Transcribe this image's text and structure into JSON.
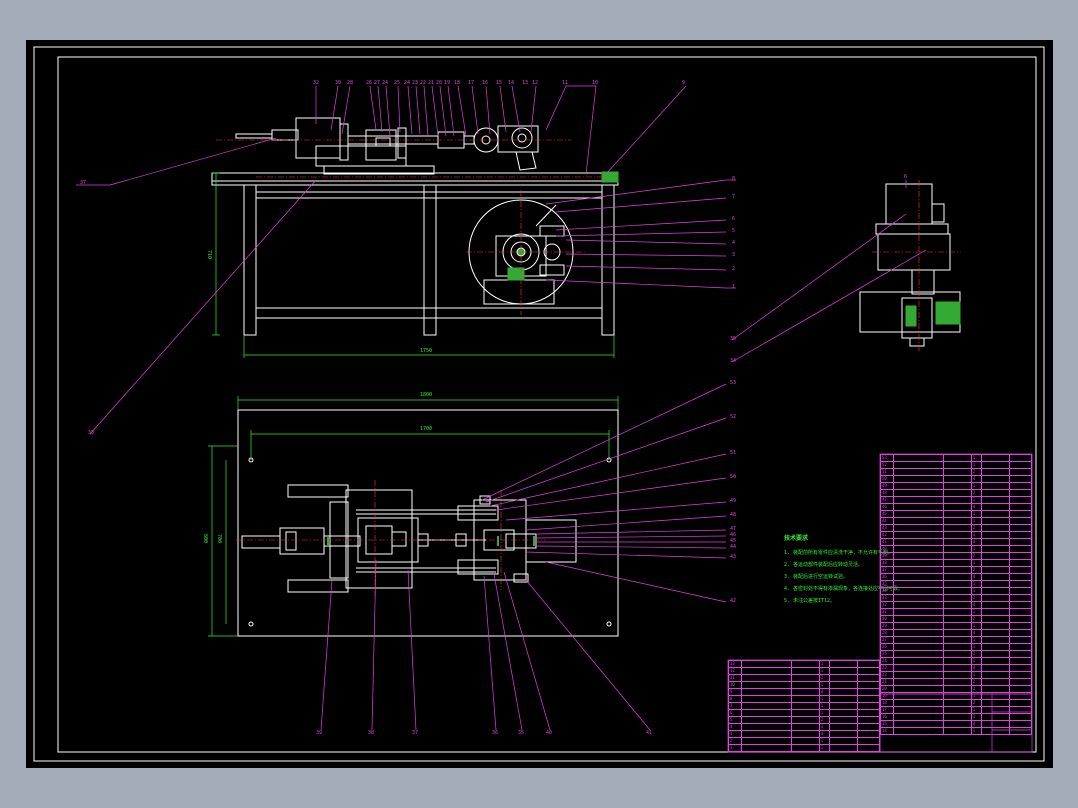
{
  "drawing": {
    "colors": {
      "background": "#000000",
      "frame_outer": "#ffffff",
      "part": "#ffffff",
      "leader": "#e040e0",
      "dimension": "#33ee33",
      "centerline": "#ff3333",
      "hatch_green": "#33aa33",
      "notes": "#33ee33"
    }
  },
  "callouts": {
    "front_top": [
      "32",
      "30",
      "28",
      "26",
      "27",
      "24",
      "25",
      "24",
      "23",
      "22",
      "21",
      "20",
      "19",
      "18",
      "17",
      "16",
      "15",
      "14",
      "13",
      "12",
      "11",
      "10",
      "9"
    ],
    "side_right": [
      "8",
      "7",
      "6",
      "5",
      "4",
      "3",
      "2",
      "1"
    ],
    "left": [
      "37",
      "33"
    ],
    "end_view": [
      "6",
      "35",
      "34"
    ],
    "plan_right": [
      "53",
      "52",
      "51",
      "50",
      "49",
      "48",
      "47",
      "46",
      "45",
      "44",
      "43",
      "42"
    ],
    "plan_bottom": [
      "39",
      "38",
      "37",
      "36",
      "35",
      "40",
      "41"
    ]
  },
  "dimensions": {
    "frame_length": "1750",
    "frame_height": "710",
    "base_length": "1800",
    "base_inner": "1700",
    "base_width": "800",
    "base_inner_width": "700"
  },
  "notes": {
    "title": "技术要求",
    "lines": [
      "1. 装配前所有零件应清洗干净，不允许有毛刺。",
      "2. 各运动部件装配后应转动灵活。",
      "3. 装配后进行空运转试验。",
      "4. 各密封处不得有渗漏现象，各连接处应牢固可靠。",
      "5. 未注公差按IT12。"
    ]
  },
  "bom_right": {
    "rows": [
      [
        "53",
        "",
        "",
        "1",
        "",
        ""
      ],
      [
        "52",
        "",
        "",
        "1",
        "",
        ""
      ],
      [
        "51",
        "",
        "",
        "2",
        "",
        ""
      ],
      [
        "50",
        "",
        "",
        "4",
        "",
        ""
      ],
      [
        "49",
        "",
        "",
        "1",
        "",
        ""
      ],
      [
        "48",
        "",
        "",
        "2",
        "",
        ""
      ],
      [
        "47",
        "",
        "",
        "1",
        "",
        ""
      ],
      [
        "46",
        "",
        "",
        "4",
        "",
        ""
      ],
      [
        "45",
        "",
        "",
        "1",
        "",
        ""
      ],
      [
        "44",
        "",
        "",
        "1",
        "",
        ""
      ],
      [
        "43",
        "",
        "",
        "2",
        "",
        ""
      ],
      [
        "42",
        "",
        "",
        "1",
        "",
        ""
      ],
      [
        "41",
        "",
        "",
        "4",
        "",
        ""
      ],
      [
        "40",
        "",
        "",
        "1",
        "",
        ""
      ],
      [
        "39",
        "",
        "",
        "2",
        "",
        ""
      ],
      [
        "38",
        "",
        "",
        "1",
        "",
        ""
      ],
      [
        "37",
        "",
        "",
        "2",
        "",
        ""
      ],
      [
        "36",
        "",
        "",
        "4",
        "",
        ""
      ],
      [
        "35",
        "",
        "",
        "1",
        "",
        ""
      ],
      [
        "34",
        "",
        "",
        "1",
        "",
        ""
      ],
      [
        "33",
        "",
        "",
        "2",
        "",
        ""
      ],
      [
        "32",
        "",
        "",
        "4",
        "",
        ""
      ],
      [
        "31",
        "",
        "",
        "1",
        "",
        ""
      ],
      [
        "30",
        "",
        "",
        "2",
        "",
        ""
      ],
      [
        "29",
        "",
        "",
        "1",
        "",
        ""
      ],
      [
        "28",
        "",
        "",
        "4",
        "",
        ""
      ],
      [
        "27",
        "",
        "",
        "1",
        "",
        ""
      ],
      [
        "26",
        "",
        "",
        "1",
        "",
        ""
      ],
      [
        "25",
        "",
        "",
        "2",
        "",
        ""
      ],
      [
        "24",
        "",
        "",
        "1",
        "",
        ""
      ],
      [
        "23",
        "",
        "",
        "4",
        "",
        ""
      ],
      [
        "22",
        "",
        "",
        "1",
        "",
        ""
      ],
      [
        "21",
        "",
        "",
        "2",
        "",
        ""
      ],
      [
        "20",
        "",
        "",
        "1",
        "",
        ""
      ],
      [
        "19",
        "",
        "",
        "1",
        "",
        ""
      ],
      [
        "18",
        "",
        "",
        "2",
        "",
        ""
      ],
      [
        "17",
        "",
        "",
        "1",
        "",
        ""
      ],
      [
        "16",
        "",
        "",
        "1",
        "",
        ""
      ],
      [
        "15",
        "",
        "",
        "4",
        "",
        ""
      ],
      [
        "14",
        "",
        "",
        "1",
        "",
        ""
      ]
    ]
  },
  "bom_left": {
    "rows": [
      [
        "13",
        "",
        "",
        "1",
        "",
        ""
      ],
      [
        "12",
        "",
        "",
        "1",
        "",
        ""
      ],
      [
        "11",
        "",
        "",
        "2",
        "",
        ""
      ],
      [
        "10",
        "",
        "",
        "1",
        "",
        ""
      ],
      [
        "9",
        "",
        "",
        "4",
        "",
        ""
      ],
      [
        "8",
        "",
        "",
        "1",
        "",
        ""
      ],
      [
        "7",
        "",
        "",
        "1",
        "",
        ""
      ],
      [
        "6",
        "",
        "",
        "1",
        "",
        ""
      ],
      [
        "5",
        "",
        "",
        "2",
        "",
        ""
      ],
      [
        "4",
        "",
        "",
        "1",
        "",
        ""
      ],
      [
        "3",
        "",
        "",
        "4",
        "",
        ""
      ],
      [
        "2",
        "",
        "",
        "1",
        "",
        ""
      ],
      [
        "1",
        "",
        "",
        "1",
        "",
        ""
      ]
    ]
  }
}
